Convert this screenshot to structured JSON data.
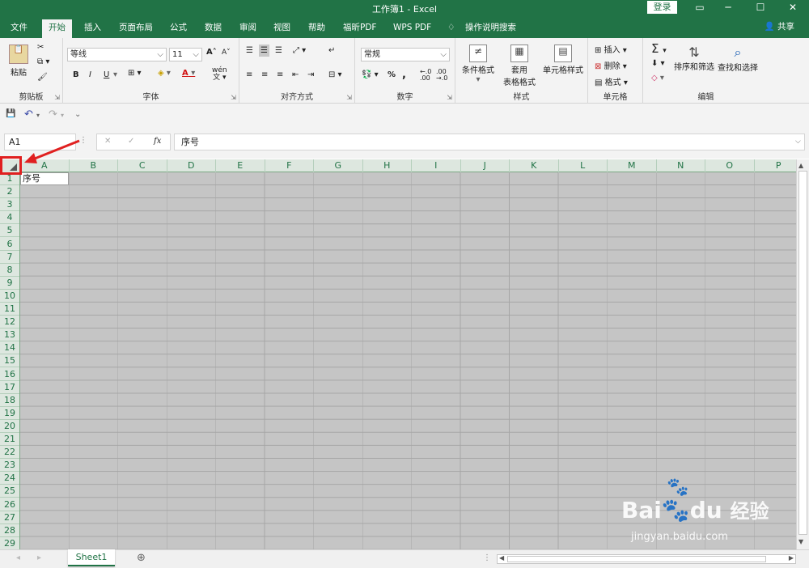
{
  "window": {
    "title": "工作簿1 - Excel",
    "login": "登录"
  },
  "tabs": [
    "文件",
    "开始",
    "插入",
    "页面布局",
    "公式",
    "数据",
    "审阅",
    "视图",
    "帮助",
    "福昕PDF",
    "WPS PDF",
    "操作说明搜索"
  ],
  "share": "共享",
  "ribbon": {
    "clipboard": {
      "paste": "粘贴",
      "label": "剪贴板"
    },
    "font": {
      "name": "等线",
      "size": "11",
      "label": "字体",
      "bold": "B",
      "italic": "I",
      "underline": "U",
      "grow": "A",
      "shrink": "A",
      "phonetic": "wén"
    },
    "align": {
      "label": "对齐方式"
    },
    "number": {
      "format": "常规",
      "label": "数字",
      "percent": "%",
      "comma": ","
    },
    "styles": {
      "cond": "条件格式",
      "table": "套用表格格式",
      "table1": "套用",
      "table2": "表格格式",
      "cell": "单元格样式",
      "label": "样式"
    },
    "cells": {
      "insert": "插入",
      "delete": "删除",
      "format": "格式",
      "label": "单元格"
    },
    "edit": {
      "sort": "排序和筛选",
      "find": "查找和选择",
      "label": "编辑"
    }
  },
  "formula": {
    "namebox": "A1",
    "value": "序号",
    "fx": "fx"
  },
  "columns": [
    "A",
    "B",
    "C",
    "D",
    "E",
    "F",
    "G",
    "H",
    "I",
    "J",
    "K",
    "L",
    "M",
    "N",
    "O",
    "P"
  ],
  "rows": [
    "1",
    "2",
    "3",
    "4",
    "5",
    "6",
    "7",
    "8",
    "9",
    "10",
    "11",
    "12",
    "13",
    "14",
    "15",
    "16",
    "17",
    "18",
    "19",
    "20",
    "21",
    "22",
    "23",
    "24",
    "25",
    "26",
    "27",
    "28",
    "29"
  ],
  "cell_a1": "序号",
  "sheet": {
    "name": "Sheet1"
  },
  "watermark": {
    "brand": "Bai",
    "brand2": "du",
    "cn": "经验",
    "url": "jingyan.baidu.com"
  },
  "colors": {
    "accent": "#217346",
    "highlight": "#e02020"
  }
}
